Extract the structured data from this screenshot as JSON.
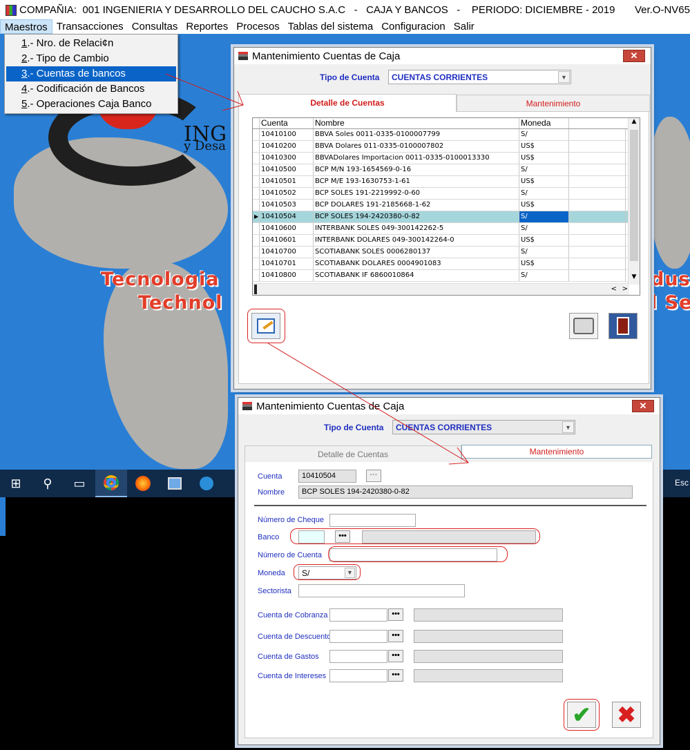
{
  "app": {
    "title": "COMPAÑIA:  001 INGENIERIA Y DESARROLLO DEL CAUCHO S.A.C   -   CAJA Y BANCOS   -    PERIODO: DICIEMBRE - 2019",
    "version": "Ver.O-NV65"
  },
  "menu": [
    "Maestros",
    "Transacciones",
    "Consultas",
    "Reportes",
    "Procesos",
    "Tablas del sistema",
    "Configuracion",
    "Salir"
  ],
  "dropdown": {
    "items": [
      {
        "num": "1",
        "label": ".- Nro. de Relaci¢n"
      },
      {
        "num": "2",
        "label": ".- Tipo de Cambio"
      },
      {
        "num": "3",
        "label": ".- Cuentas de bancos"
      },
      {
        "num": "4",
        "label": ".- Codificación de Bancos"
      },
      {
        "num": "5",
        "label": ".- Operaciones Caja Banco"
      }
    ]
  },
  "background": {
    "slogan1a": "Tecnologia",
    "slogan1b": "dus",
    "slogan2a": "Technol",
    "slogan2b": "l Se",
    "logo_text_a": "ING",
    "logo_text_b": "y Desa"
  },
  "taskbar": {
    "tray": "Esc"
  },
  "win1": {
    "title": "Mantenimiento Cuentas de Caja",
    "close": "✕",
    "tipo_label": "Tipo de Cuenta",
    "tipo_value": "CUENTAS CORRIENTES",
    "tab_detalle": "Detalle de Cuentas",
    "tab_mant": "Mantenimiento",
    "columns": [
      "Cuenta",
      "Nombre",
      "Moneda"
    ],
    "rows": [
      [
        "10410100",
        "BBVA Soles 0011-0335-0100007799",
        "S/"
      ],
      [
        "10410200",
        "BBVA Dolares 011-0335-0100007802",
        "US$"
      ],
      [
        "10410300",
        "BBVADolares Importacion 0011-0335-0100013330",
        "US$"
      ],
      [
        "10410500",
        "BCP M/N 193-1654569-0-16",
        "S/"
      ],
      [
        "10410501",
        "BCP M/E 193-1630753-1-61",
        "US$"
      ],
      [
        "10410502",
        "BCP SOLES 191-2219992-0-60",
        "S/"
      ],
      [
        "10410503",
        "BCP DOLARES 191-2185668-1-62",
        "US$"
      ],
      [
        "10410504",
        "BCP SOLES 194-2420380-0-82",
        "S/"
      ],
      [
        "10410600",
        "INTERBANK SOLES 049-300142262-5",
        "S/"
      ],
      [
        "10410601",
        "INTERBANK DOLARES 049-300142264-0",
        "US$"
      ],
      [
        "10410700",
        "SCOTIABANK SOLES 0006280137",
        "S/"
      ],
      [
        "10410701",
        "SCOTIABANK DOLARES 0004901083",
        "US$"
      ],
      [
        "10410800",
        "SCOTIABANK IF 6860010864",
        "S/"
      ]
    ],
    "selected_row": 7
  },
  "win2": {
    "title": "Mantenimiento Cuentas de Caja",
    "close": "✕",
    "tipo_label": "Tipo de Cuenta",
    "tipo_value": "CUENTAS CORRIENTES",
    "tab_detalle": "Detalle de Cuentas",
    "tab_mant": "Mantenimiento",
    "cuenta_label": "Cuenta",
    "cuenta_value": "10410504",
    "nombre_label": "Nombre",
    "nombre_value": "BCP SOLES 194-2420380-0-82",
    "cheque_label": "Número de Cheque",
    "banco_label": "Banco",
    "numcuenta_label": "Número de Cuenta",
    "moneda_label": "Moneda",
    "moneda_value": "S/",
    "sectorista_label": "Sectorista",
    "cobranza_label": "Cuenta de Cobranza",
    "descuento_label": "Cuenta de Descuento",
    "gastos_label": "Cuenta de Gastos",
    "intereses_label": "Cuenta de Intereses",
    "ellipsis": "···",
    "ellipsis_dark": "•••"
  }
}
